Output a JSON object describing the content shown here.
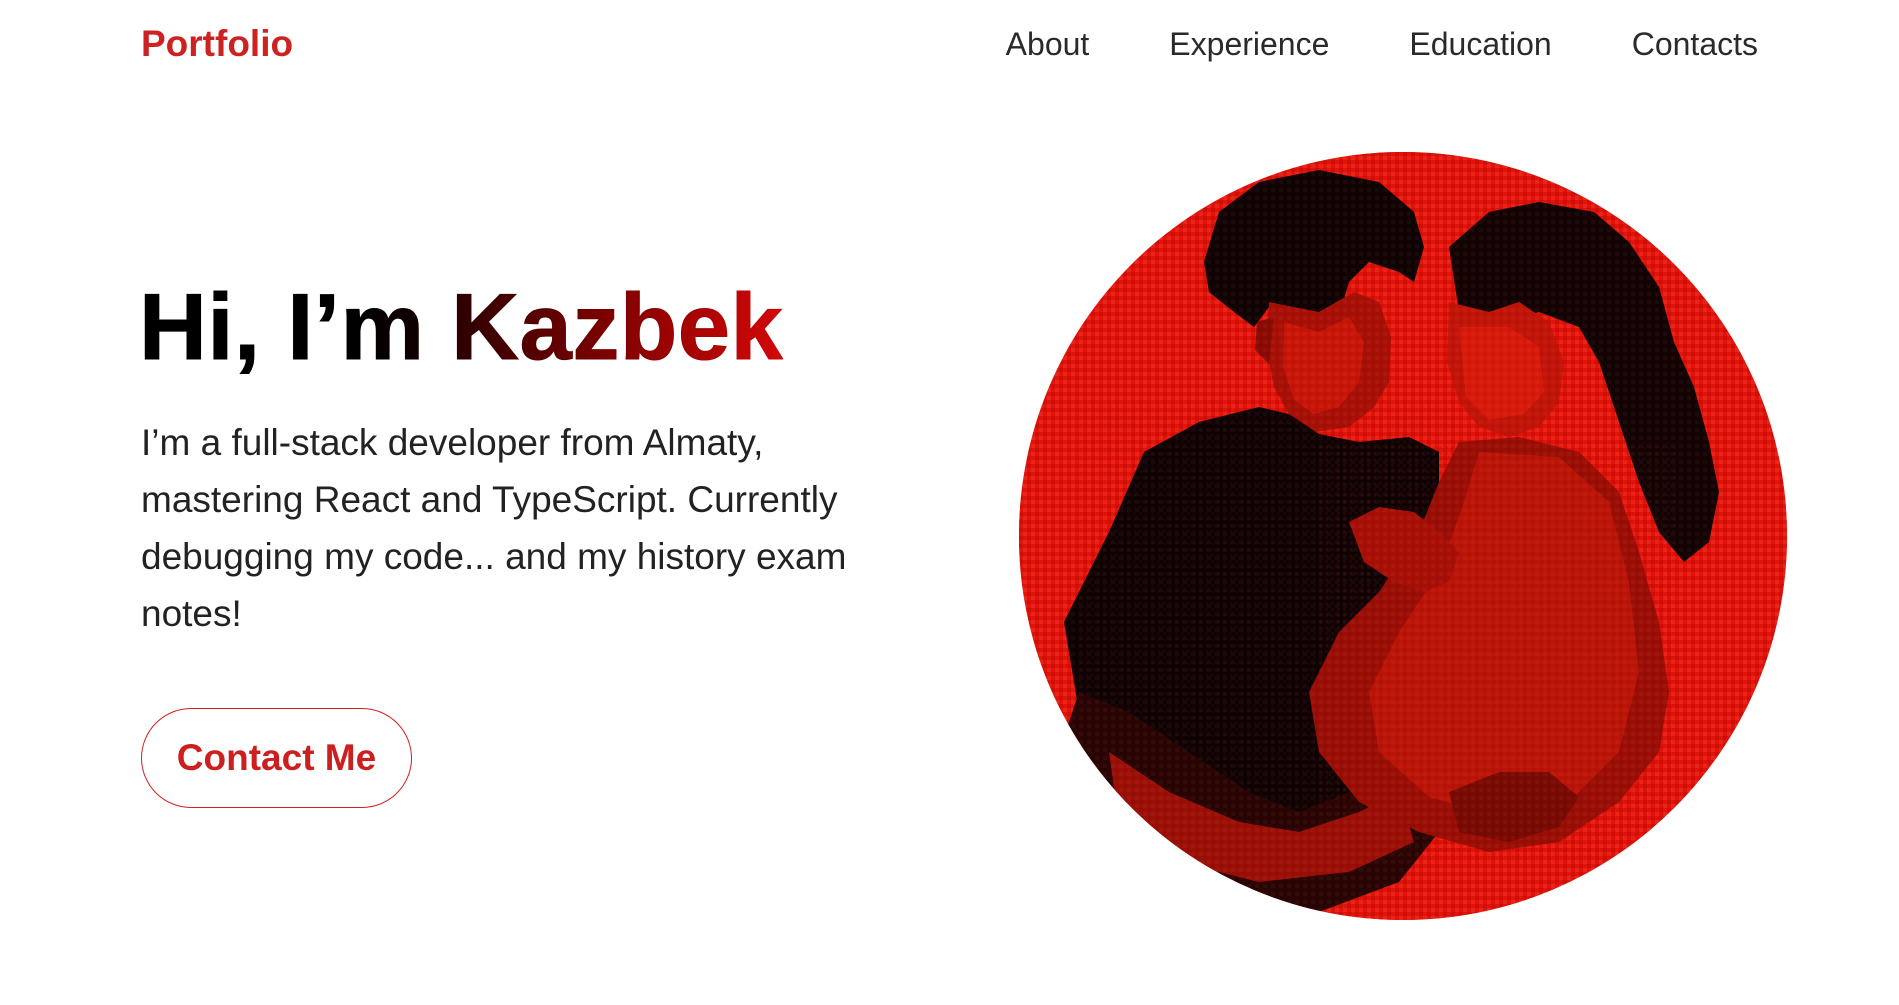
{
  "header": {
    "logo": "Portfolio",
    "nav": [
      {
        "label": "About"
      },
      {
        "label": "Experience"
      },
      {
        "label": "Education"
      },
      {
        "label": "Contacts"
      }
    ]
  },
  "hero": {
    "greeting": "Hi, I’m ",
    "name": "Kazbek",
    "description": "I’m a full-stack developer from Almaty, mastering React and TypeScript. Currently debugging my code... and my history exam notes!",
    "cta_label": "Contact Me"
  },
  "colors": {
    "accent": "#cc2222",
    "portrait_background": "#e41208",
    "portrait_shadow": "#0a0000"
  }
}
